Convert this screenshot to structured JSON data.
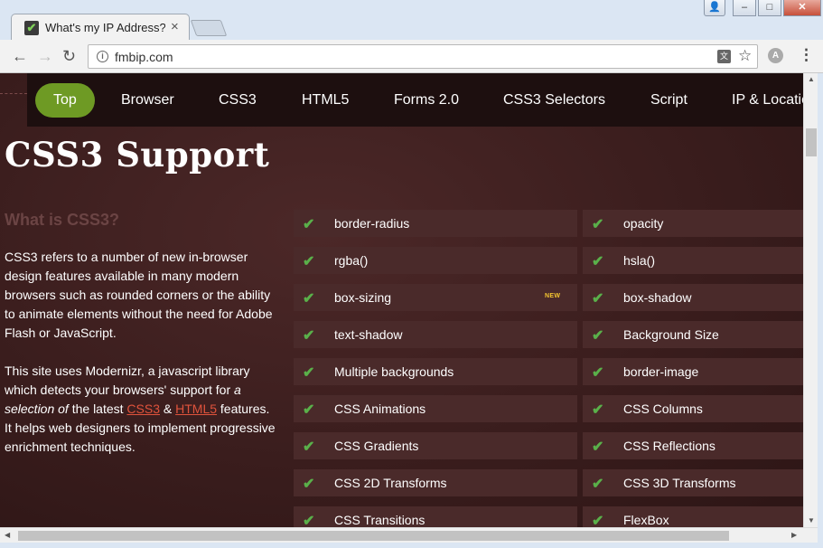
{
  "tab": {
    "title": "What's my IP Address?",
    "close": "×"
  },
  "window_controls": {
    "profile": "👤",
    "minimize": "–",
    "maximize": "□",
    "close": "✕"
  },
  "toolbar": {
    "back": "←",
    "forward": "→",
    "reload": "↻",
    "url": "fmbip.com",
    "star": "☆",
    "menu": "⋮"
  },
  "nav": {
    "items": [
      "Top",
      "Browser",
      "CSS3",
      "HTML5",
      "Forms 2.0",
      "CSS3 Selectors",
      "Script",
      "IP & Location"
    ],
    "active_color": "#6e9a24"
  },
  "page": {
    "title": "CSS3 Support",
    "subtitle": "What is CSS3?",
    "para1": "CSS3 refers to a number of new in-browser design features available in many modern browsers such as rounded corners or the ability to animate elements without the need for Adobe Flash or JavaScript.",
    "para2_start": "This site uses Modernizr, a javascript library which detects your browsers' support for ",
    "para2_em": "a selection of",
    "para2_mid": " the latest ",
    "link_css3": "CSS3",
    "amp": " & ",
    "link_html5": "HTML5",
    "para2_end": " features. It helps web designers to implement progressive enrichment techniques."
  },
  "features": {
    "left": [
      "border-radius",
      "rgba()",
      "box-sizing",
      "text-shadow",
      "Multiple backgrounds",
      "CSS Animations",
      "CSS Gradients",
      "CSS 2D Transforms",
      "CSS Transitions"
    ],
    "right": [
      "opacity",
      "hsla()",
      "box-shadow",
      "Background Size",
      "border-image",
      "CSS Columns",
      "CSS Reflections",
      "CSS 3D Transforms",
      "FlexBox"
    ],
    "new_badge": "NEW",
    "check_color": "#5ab04a"
  }
}
